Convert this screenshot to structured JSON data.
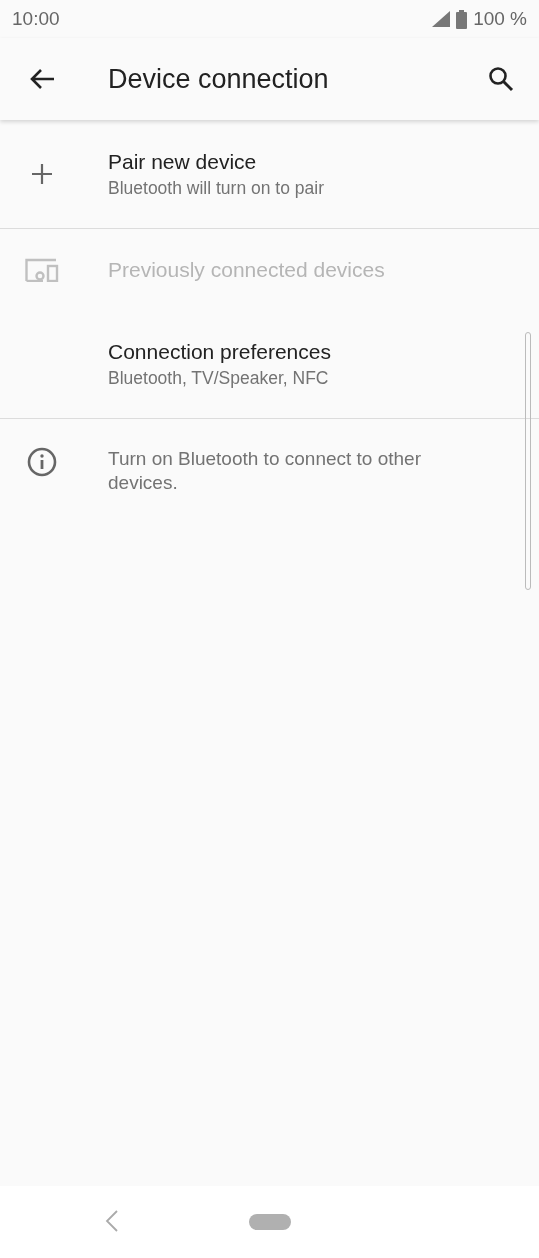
{
  "status_bar": {
    "time": "10:00",
    "battery": "100 %"
  },
  "app_bar": {
    "title": "Device connection"
  },
  "items": [
    {
      "kind": "add",
      "title": "Pair new device",
      "summary": "Bluetooth will turn on to pair",
      "disabled": false,
      "divider": true
    },
    {
      "kind": "history",
      "title": "Previously connected devices",
      "disabled": true,
      "divider": false
    },
    {
      "kind": "plain",
      "title": "Connection preferences",
      "summary": "Bluetooth, TV/Speaker, NFC",
      "disabled": false,
      "divider": true
    }
  ],
  "footer": {
    "text": "Turn on Bluetooth to connect to other devices."
  }
}
